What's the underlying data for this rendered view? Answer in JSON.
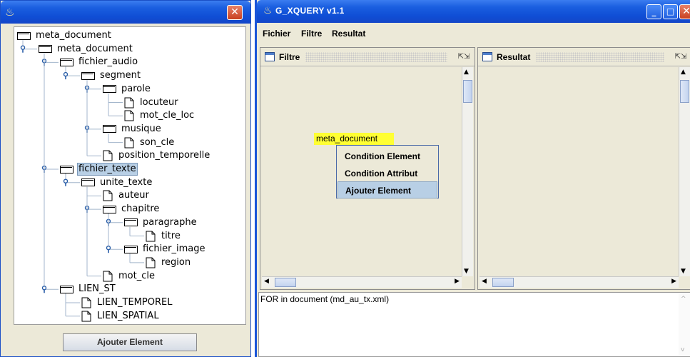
{
  "left_window": {
    "tree": [
      {
        "label": "meta_document",
        "type": "folder",
        "depth": 0,
        "selected": false
      },
      {
        "label": "meta_document",
        "type": "folder",
        "depth": 1,
        "selected": false
      },
      {
        "label": "fichier_audio",
        "type": "folder",
        "depth": 2,
        "selected": false
      },
      {
        "label": "segment",
        "type": "folder",
        "depth": 3,
        "selected": false
      },
      {
        "label": "parole",
        "type": "folder",
        "depth": 4,
        "selected": false
      },
      {
        "label": "locuteur",
        "type": "file",
        "depth": 5,
        "selected": false
      },
      {
        "label": "mot_cle_loc",
        "type": "file",
        "depth": 5,
        "selected": false
      },
      {
        "label": "musique",
        "type": "folder",
        "depth": 4,
        "selected": false
      },
      {
        "label": "son_cle",
        "type": "file",
        "depth": 5,
        "selected": false
      },
      {
        "label": "position_temporelle",
        "type": "file",
        "depth": 4,
        "selected": false
      },
      {
        "label": "fichier_texte",
        "type": "folder",
        "depth": 2,
        "selected": true
      },
      {
        "label": "unite_texte",
        "type": "folder",
        "depth": 3,
        "selected": false
      },
      {
        "label": "auteur",
        "type": "file",
        "depth": 4,
        "selected": false
      },
      {
        "label": "chapitre",
        "type": "folder",
        "depth": 4,
        "selected": false
      },
      {
        "label": "paragraphe",
        "type": "folder",
        "depth": 5,
        "selected": false
      },
      {
        "label": "titre",
        "type": "file",
        "depth": 6,
        "selected": false
      },
      {
        "label": "fichier_image",
        "type": "folder",
        "depth": 5,
        "selected": false
      },
      {
        "label": "region",
        "type": "file",
        "depth": 6,
        "selected": false
      },
      {
        "label": "mot_cle",
        "type": "file",
        "depth": 4,
        "selected": false
      },
      {
        "label": "LIEN_ST",
        "type": "folder",
        "depth": 2,
        "selected": false
      },
      {
        "label": "LIEN_TEMPOREL",
        "type": "file",
        "depth": 3,
        "selected": false
      },
      {
        "label": "LIEN_SPATIAL",
        "type": "file",
        "depth": 3,
        "selected": false
      }
    ],
    "add_button_label": "Ajouter Element",
    "close_glyph": "✕"
  },
  "right_window": {
    "title": "G_XQUERY v1.1",
    "menu": [
      "Fichier",
      "Filtre",
      "Resultat"
    ],
    "filtre_panel_title": "Filtre",
    "resultat_panel_title": "Resultat",
    "node_label": "meta_document",
    "popup_items": [
      "Condition Element",
      "Condition Attribut",
      "Ajouter Element"
    ],
    "popup_active_index": 2,
    "query_text": "FOR  in document  (md_au_tx.xml)"
  },
  "colors": {
    "titlebar": "#1b5fe0",
    "selection": "#b8cfe5",
    "node_highlight": "#ffff33"
  },
  "icons": [
    "java-icon",
    "folder-icon",
    "file-icon",
    "tree-handle-icon",
    "close-icon",
    "minimize-icon",
    "maximize-icon",
    "panel-window-icon",
    "scroll-arrow-icon"
  ]
}
